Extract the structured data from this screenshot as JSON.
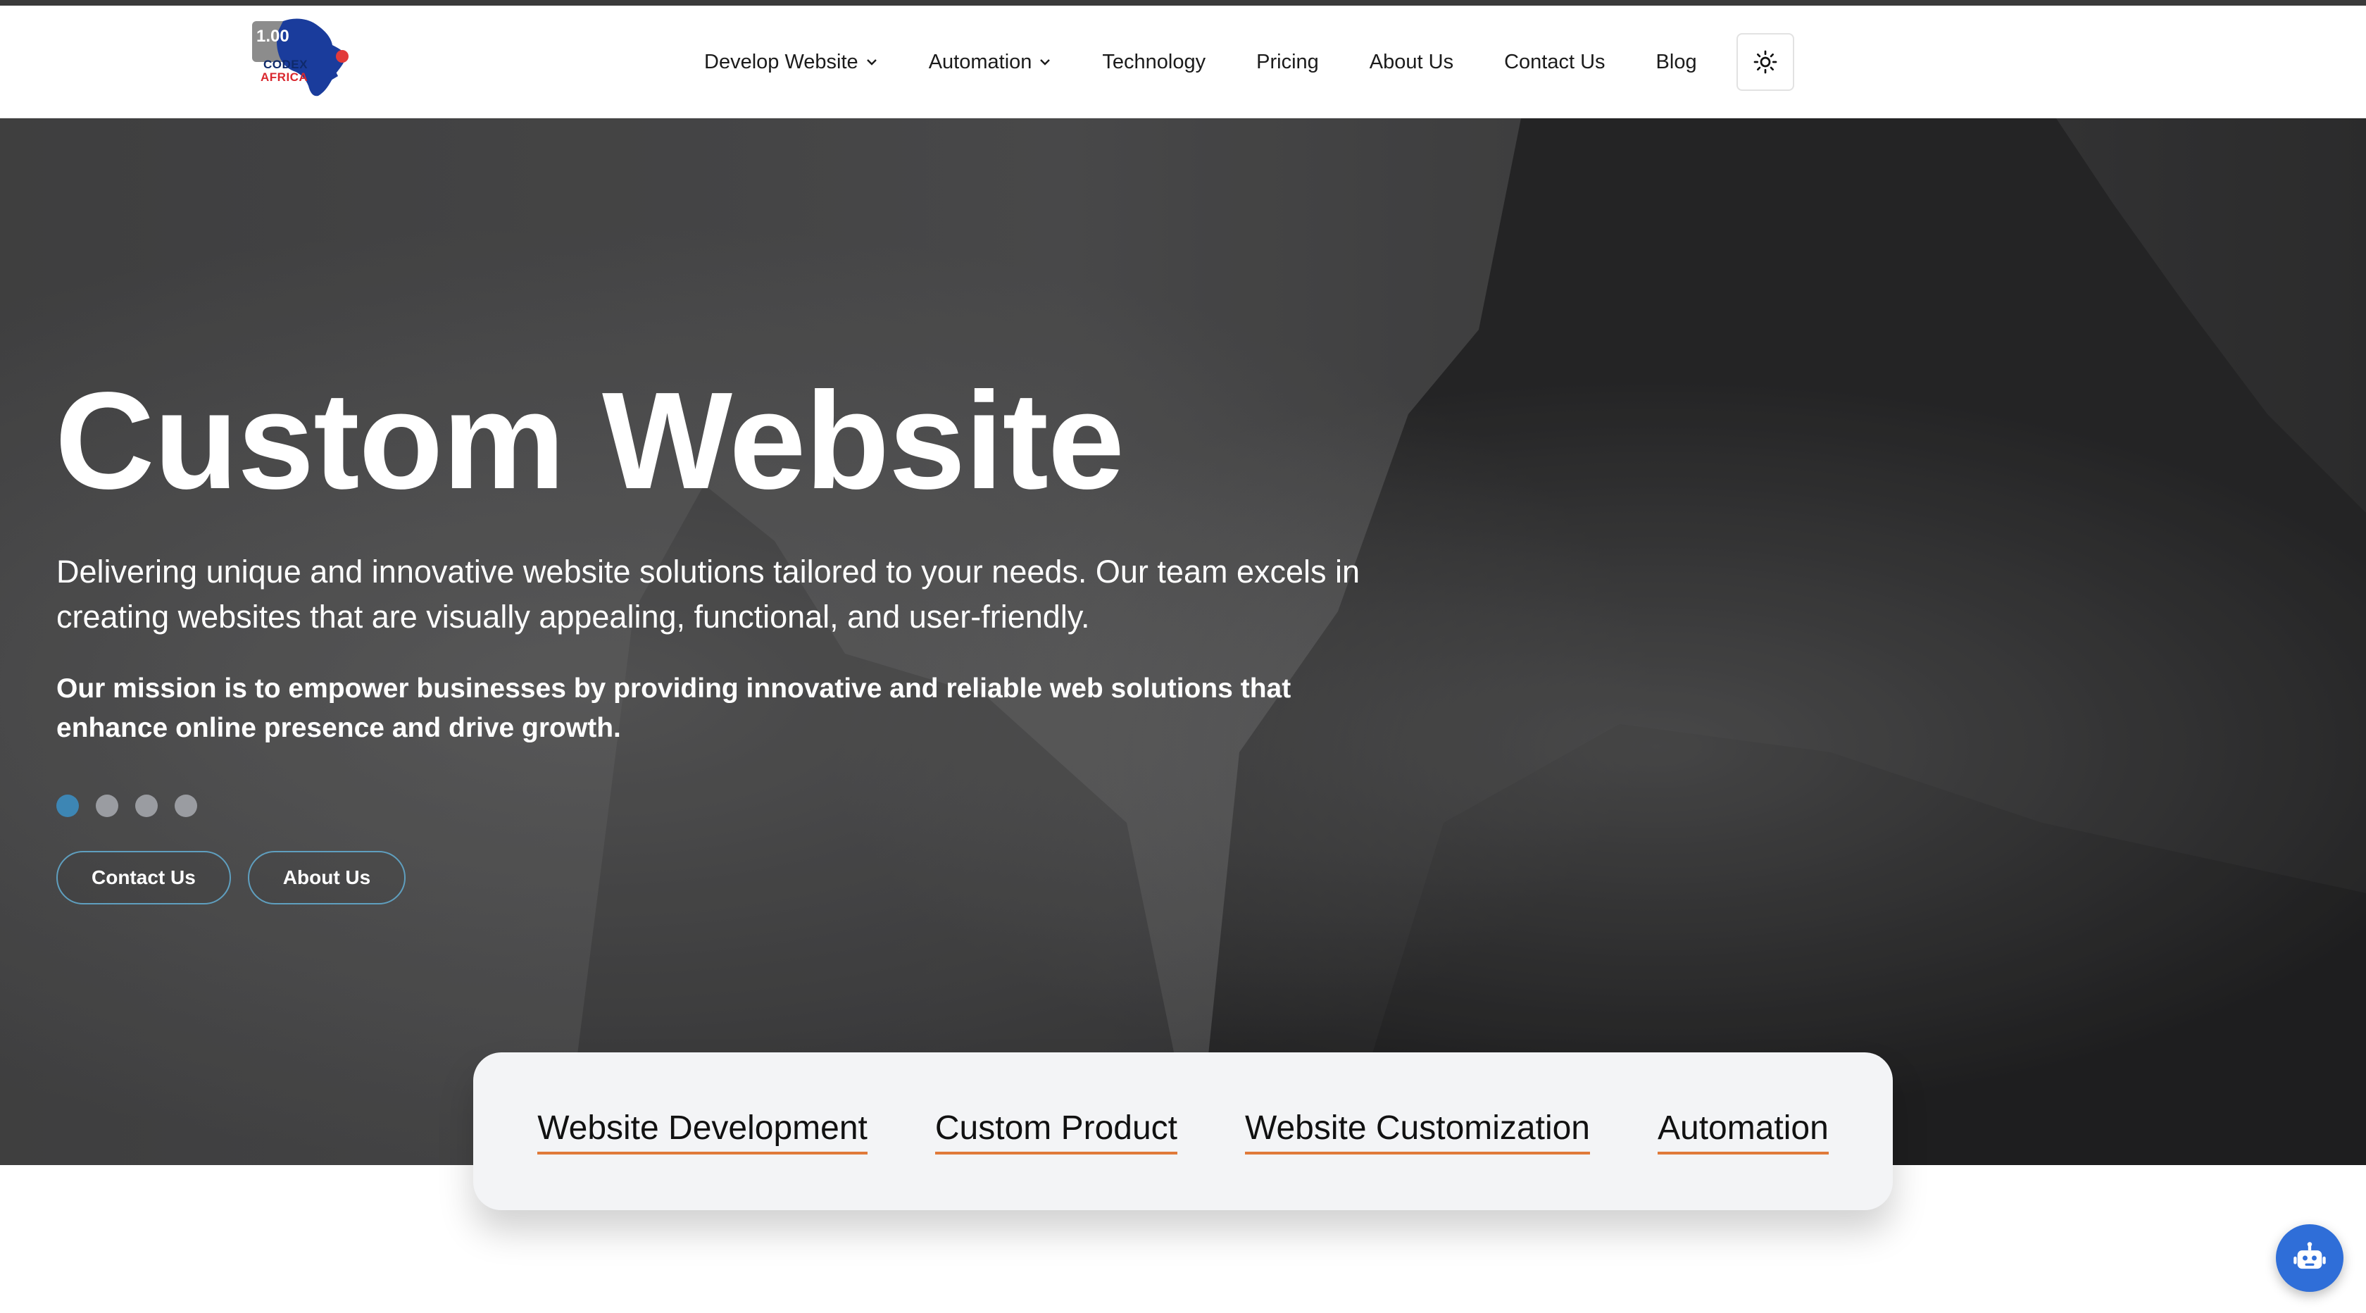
{
  "header": {
    "logo": {
      "version": "1.00",
      "word1": "CODEX",
      "word2": "AFRICA"
    },
    "nav": [
      {
        "label": "Develop Website",
        "has_dropdown": true
      },
      {
        "label": "Automation",
        "has_dropdown": true
      },
      {
        "label": "Technology",
        "has_dropdown": false
      },
      {
        "label": "Pricing",
        "has_dropdown": false
      },
      {
        "label": "About Us",
        "has_dropdown": false
      },
      {
        "label": "Contact Us",
        "has_dropdown": false
      },
      {
        "label": "Blog",
        "has_dropdown": false
      }
    ],
    "theme_toggle_icon": "sun-icon"
  },
  "hero": {
    "title": "Custom Website",
    "description": "Delivering unique and innovative website solutions tailored to your needs. Our team excels in creating websites that are visually appealing, functional, and user-friendly.",
    "mission": "Our mission is to empower businesses by providing innovative and reliable web solutions that enhance online presence and drive growth.",
    "slides": 4,
    "active_slide": 1,
    "buttons": {
      "primary": "Contact Us",
      "secondary": "About Us"
    }
  },
  "features": [
    "Website Development",
    "Custom Product",
    "Website Customization",
    "Automation"
  ],
  "chat_icon": "robot-icon",
  "colors": {
    "accent_blue": "#3d86b4",
    "underline_orange": "#e07a3a",
    "chat_blue": "#2f6ed8"
  }
}
